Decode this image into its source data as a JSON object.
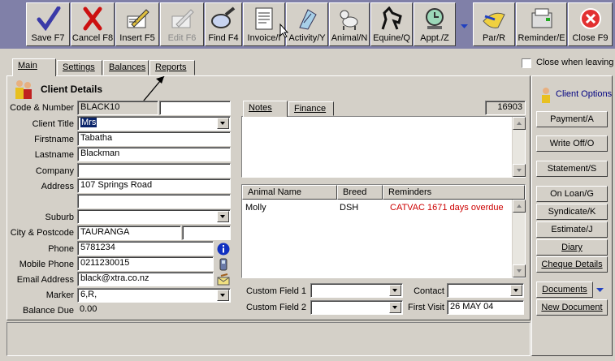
{
  "toolbar": {
    "buttons": [
      {
        "label": "Save F7",
        "icon": "save-check-icon"
      },
      {
        "label": "Cancel F8",
        "icon": "cancel-x-icon"
      },
      {
        "label": "Insert F5",
        "icon": "insert-pencil-icon"
      },
      {
        "label": "Edit F6",
        "icon": "edit-pencil-icon"
      },
      {
        "label": "Find F4",
        "icon": "magnifier-icon"
      },
      {
        "label": "Invoice/I",
        "icon": "invoice-document-icon"
      },
      {
        "label": "Activity/Y",
        "icon": "activity-icon"
      },
      {
        "label": "Animal/N",
        "icon": "dog-icon"
      },
      {
        "label": "Equine/Q",
        "icon": "horse-icon"
      },
      {
        "label": "Appt./Z",
        "icon": "clock-icon"
      },
      {
        "label": "Par/R",
        "icon": "parcel-icon"
      },
      {
        "label": "Reminder/E",
        "icon": "reminder-icon"
      },
      {
        "label": "Close F9",
        "icon": "close-circle-icon"
      }
    ]
  },
  "tabs": {
    "main": "Main",
    "settings": "Settings",
    "balances": "Balances",
    "reports": "Reports"
  },
  "close_when_leaving": "Close when leaving",
  "client_details": {
    "title": "Client Details",
    "labels": {
      "code": "Code & Number",
      "title": "Client Title",
      "firstname": "Firstname",
      "lastname": "Lastname",
      "company": "Company",
      "address": "Address",
      "suburb": "Suburb",
      "city": "City & Postcode",
      "phone": "Phone",
      "mobile": "Mobile Phone",
      "email": "Email Address",
      "marker": "Marker",
      "balance": "Balance Due"
    },
    "values": {
      "code": "BLACK10",
      "number": "",
      "title": "Mrs",
      "firstname": "Tabatha",
      "lastname": "Blackman",
      "company": "",
      "address1": "107 Springs Road",
      "address2": "",
      "suburb": "",
      "city": "TAURANGA",
      "postcode": "",
      "phone": "5781234",
      "mobile": "0211230015",
      "email": "black@xtra.co.nz",
      "marker": "6,R,",
      "balance": "0.00"
    }
  },
  "notes": {
    "tab_notes": "Notes",
    "tab_finance": "Finance",
    "record_number": "16903",
    "content": ""
  },
  "animals": {
    "columns": [
      "Animal Name",
      "Breed",
      "Reminders"
    ],
    "rows": [
      {
        "name": "Molly",
        "breed": "DSH",
        "reminder": "CATVAC 1671 days overdue"
      }
    ],
    "reminder_color": "#cc0000"
  },
  "custom": {
    "field1_label": "Custom Field 1",
    "field1_value": "",
    "field2_label": "Custom Field 2",
    "field2_value": "",
    "contact_label": "Contact",
    "contact_value": "",
    "first_visit_label": "First Visit",
    "first_visit_value": "26 MAY 04"
  },
  "client_options": {
    "title": "Client Options",
    "buttons": [
      "Payment/A",
      "Write Off/O",
      "Statement/S",
      "On Loan/G",
      "Syndicate/K",
      "Estimate/J",
      "Diary",
      "Cheque Details",
      "Documents",
      "New Document"
    ]
  },
  "colors": {
    "toolbar_bg": "#8080a8",
    "window_bg": "#d4d0c8",
    "option_title": "#000080"
  }
}
